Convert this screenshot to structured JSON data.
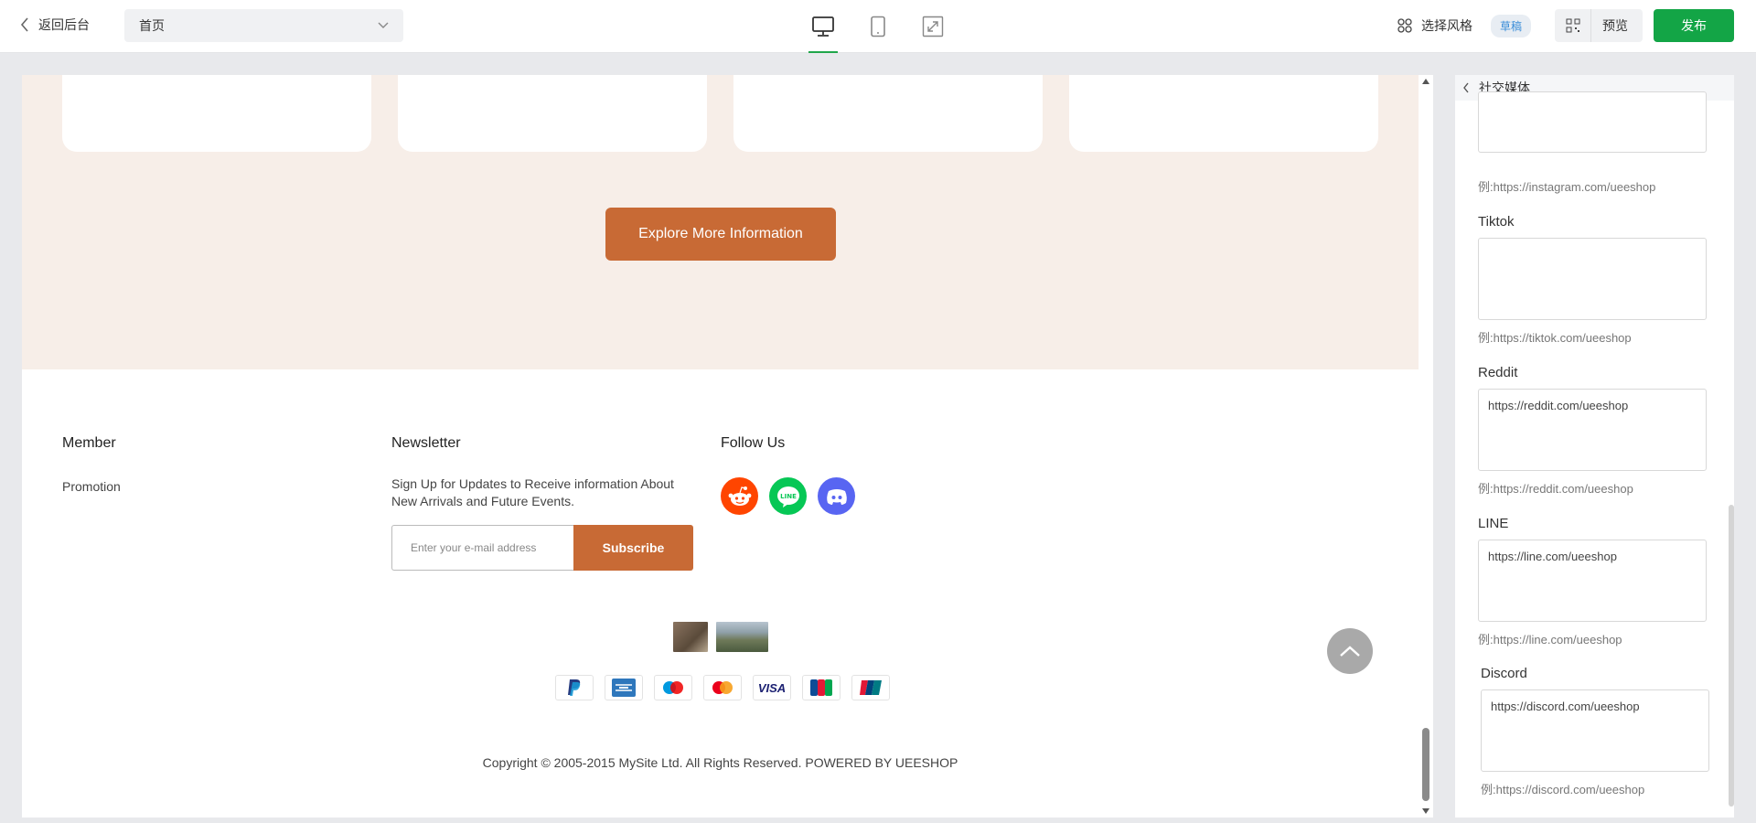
{
  "topbar": {
    "back_label": "返回后台",
    "page_select_value": "首页",
    "style_label": "选择风格",
    "draft_badge": "草稿",
    "preview_label": "预览",
    "publish_label": "发布"
  },
  "canvas": {
    "explore_label": "Explore More Information",
    "footer": {
      "member_title": "Member",
      "member_links": [
        "Promotion"
      ],
      "newsletter_title": "Newsletter",
      "newsletter_text": "Sign Up for Updates to Receive information About New Arrivals and Future Events.",
      "email_placeholder": "Enter your e-mail address",
      "subscribe_label": "Subscribe",
      "follow_title": "Follow Us",
      "social_icons": [
        "reddit-icon",
        "line-icon",
        "discord-icon"
      ],
      "payment_icons": [
        "paypal-icon",
        "amex-icon",
        "maestro-icon",
        "mastercard-icon",
        "visa-icon",
        "jcb-icon",
        "unionpay-icon"
      ],
      "visa_text": "VISA",
      "copyright": "Copyright © 2005-2015 MySite Ltd. All Rights Reserved. POWERED BY UEESHOP"
    }
  },
  "panel": {
    "title": "社交媒体",
    "fields": [
      {
        "label": "",
        "value": "",
        "hint": "例:https://instagram.com/ueeshop"
      },
      {
        "label": "Tiktok",
        "value": "",
        "hint": "例:https://tiktok.com/ueeshop"
      },
      {
        "label": "Reddit",
        "value": "https://reddit.com/ueeshop",
        "hint": "例:https://reddit.com/ueeshop"
      },
      {
        "label": "LINE",
        "value": "https://line.com/ueeshop",
        "hint": "例:https://line.com/ueeshop"
      },
      {
        "label": "Discord",
        "value": "https://discord.com/ueeshop",
        "hint": "例:https://discord.com/ueeshop"
      }
    ]
  },
  "colors": {
    "accent": "#c86a35",
    "publish": "#13a546",
    "promo_bg": "#f7eee8",
    "reddit": "#ff4500",
    "line": "#06c755",
    "discord": "#5865f2"
  }
}
